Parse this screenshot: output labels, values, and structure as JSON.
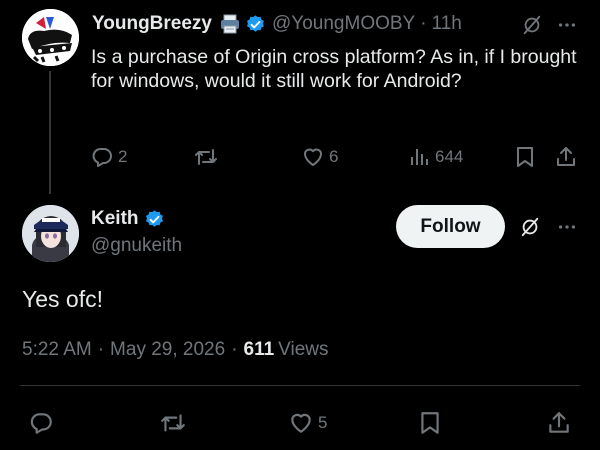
{
  "parent_tweet": {
    "display_name": "YoungBreezy",
    "handle": "@YoungMOOBY",
    "separator": "·",
    "time_ago": "11h",
    "text": "Is a purchase of Origin cross platform? As in, if I brought for windows, would it still work for Android?",
    "replies": "2",
    "likes": "6",
    "views": "644",
    "icons": [
      "printer-emoji-icon",
      "verified-badge-icon",
      "grok-icon",
      "more-icon",
      "reply-icon",
      "retweet-icon",
      "like-icon",
      "views-icon",
      "bookmark-icon",
      "share-icon"
    ]
  },
  "reply_tweet": {
    "display_name": "Keith",
    "handle": "@gnukeith",
    "follow_label": "Follow",
    "text": "Yes ofc!",
    "time": "5:22 AM",
    "date": "May 29, 2026",
    "separator": "·",
    "views_count": "611",
    "views_label": "Views",
    "likes": "5",
    "icons": [
      "verified-badge-icon",
      "grok-icon",
      "more-icon",
      "reply-icon",
      "retweet-icon",
      "like-icon",
      "bookmark-icon",
      "share-icon"
    ]
  },
  "colors": {
    "background": "#000000",
    "text_primary": "#e7e9ea",
    "text_secondary": "#71767b",
    "verified_blue": "#1d9bf0",
    "follow_button_bg": "#eff3f4"
  }
}
